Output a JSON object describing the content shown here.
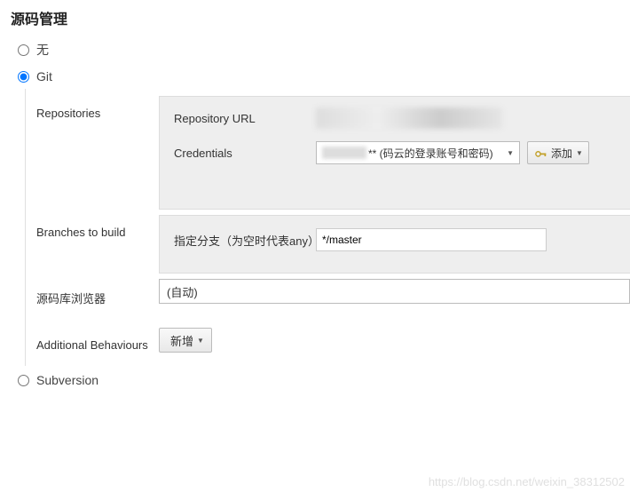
{
  "header": {
    "title": "源码管理"
  },
  "scm": {
    "options": {
      "none": {
        "label": "无",
        "selected": false
      },
      "git": {
        "label": "Git",
        "selected": true
      },
      "svn": {
        "label": "Subversion",
        "selected": false
      }
    }
  },
  "git": {
    "repositories": {
      "label": "Repositories",
      "url_label": "Repository URL",
      "url_value": "",
      "credentials_label": "Credentials",
      "credentials_selected": "** (码云的登录账号和密码)",
      "add_label": "添加"
    },
    "branches": {
      "label": "Branches to build",
      "spec_label": "指定分支（为空时代表any）",
      "spec_value": "*/master"
    },
    "browser": {
      "label": "源码库浏览器",
      "selected": "(自动)"
    },
    "behaviours": {
      "label": "Additional Behaviours",
      "add_label": "新增"
    }
  },
  "watermark": "https://blog.csdn.net/weixin_38312502"
}
